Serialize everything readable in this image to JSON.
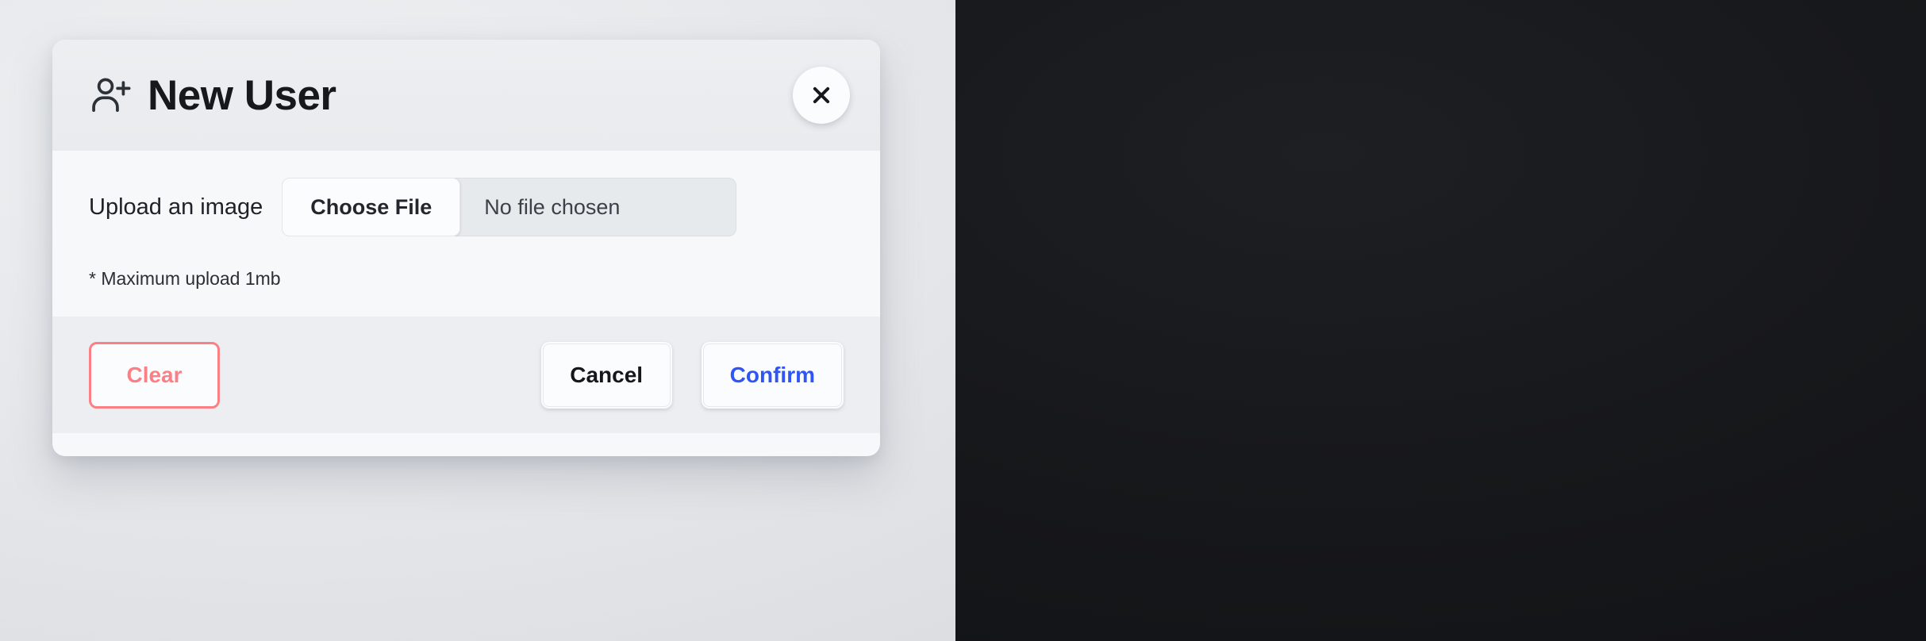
{
  "theme_panes": {
    "light": {
      "name": "light-theme-pane",
      "page_background": "#e6e8eb"
    },
    "dark": {
      "name": "dark-theme-pane",
      "page_background": "#17181b"
    }
  },
  "dialog": {
    "title": "New User",
    "title_icon": "user-plus-icon",
    "close_icon": "close-icon",
    "close_label": "✕",
    "upload_label": "Upload an image",
    "choose_file_label": "Choose File",
    "file_name": "No file chosen",
    "hint": "* Maximum upload 1mb",
    "buttons": {
      "clear": "Clear",
      "cancel": "Cancel",
      "confirm": "Confirm"
    }
  },
  "colors": {
    "light_card_bg": "#f7f8f9",
    "light_header_bg": "#eceef1",
    "light_footer_bg": "#eceef1",
    "light_title": "#16181c",
    "light_clear_accent": "#fb8085",
    "light_confirm_accent": "#2f55f5",
    "light_file_field_bg": "#e7eaec",
    "dark_card_bg": "#383d45",
    "dark_header_bg": "#212429",
    "dark_footer_bg": "#1d2025",
    "dark_title": "#ffffff",
    "dark_clear_accent": "#f4d7d7",
    "dark_confirm_accent": "#8c9bfa",
    "dark_file_field_bg": "#1b1d21",
    "dark_choose_file_bg": "#4e545d",
    "dark_cancel_bg": "#4c525b"
  }
}
